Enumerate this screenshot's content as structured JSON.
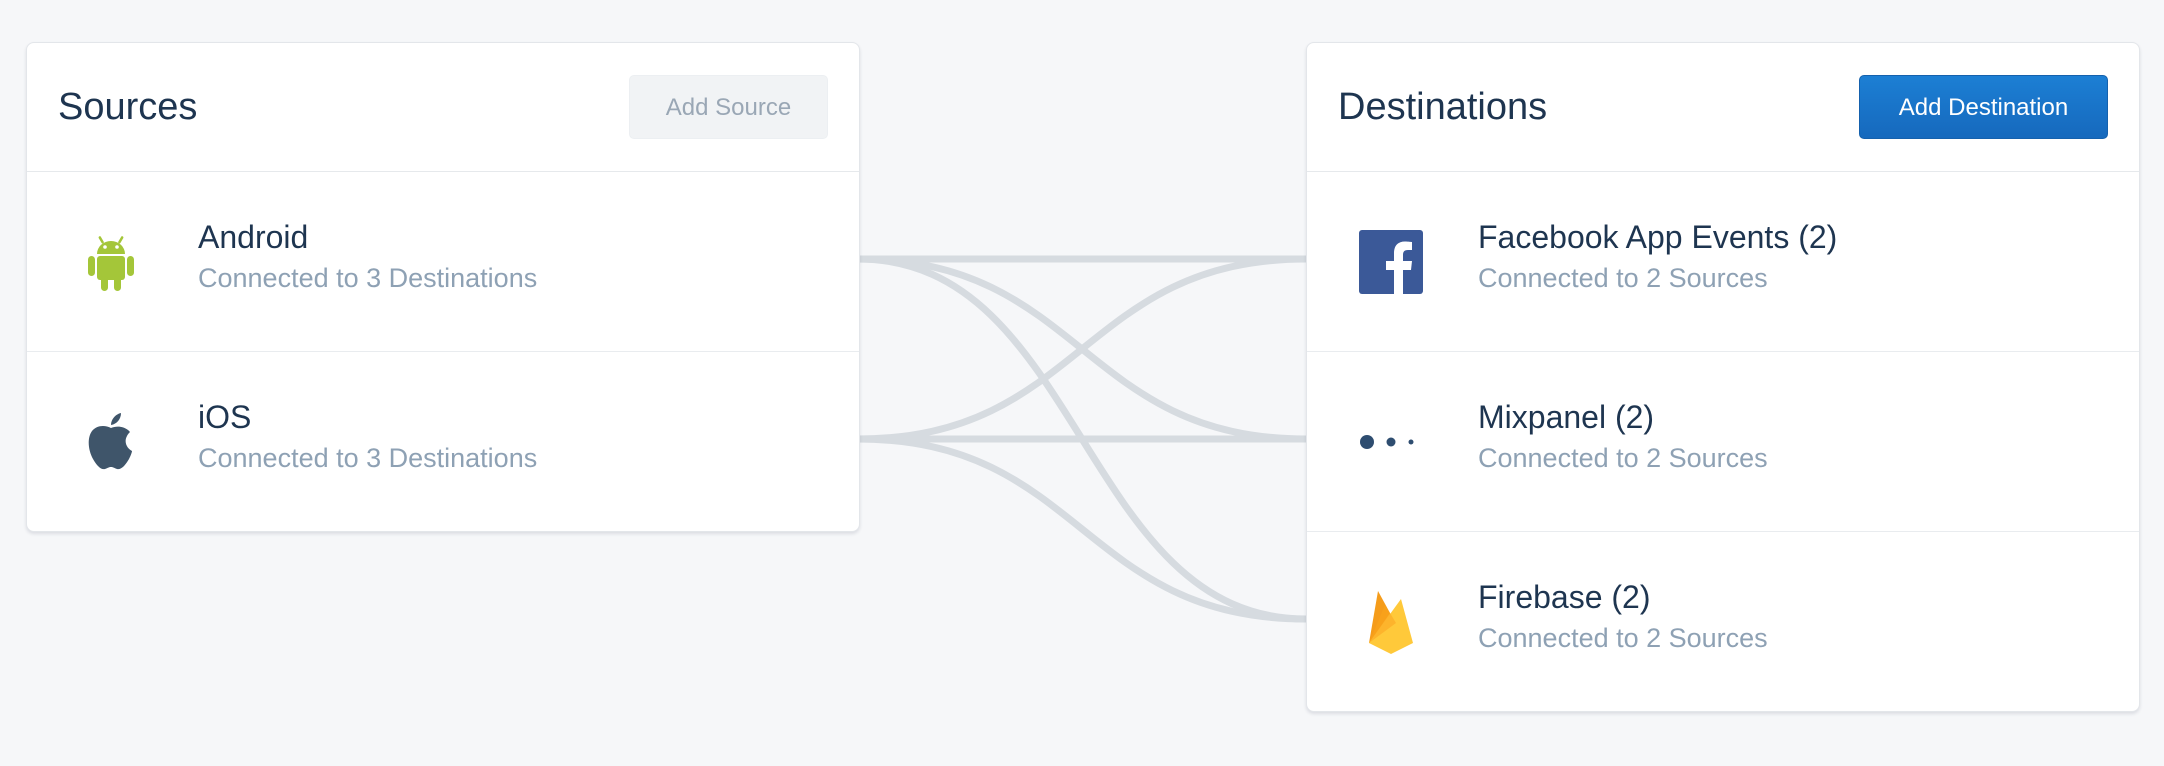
{
  "colors": {
    "page_background": "#f6f7f9",
    "title_text": "#1e3550",
    "secondary_text": "#8ea1b4",
    "primary_button": "#1876cc",
    "connection_line": "#d6dbe0"
  },
  "sources": {
    "title": "Sources",
    "add_button_label": "Add Source",
    "items": [
      {
        "name": "Android",
        "subtitle": "Connected to 3 Destinations",
        "icon": "android-icon"
      },
      {
        "name": "iOS",
        "subtitle": "Connected to 3 Destinations",
        "icon": "apple-icon"
      }
    ]
  },
  "destinations": {
    "title": "Destinations",
    "add_button_label": "Add Destination",
    "items": [
      {
        "name": "Facebook App Events (2)",
        "subtitle": "Connected to 2 Sources",
        "icon": "facebook-icon"
      },
      {
        "name": "Mixpanel (2)",
        "subtitle": "Connected to 2 Sources",
        "icon": "mixpanel-icon"
      },
      {
        "name": "Firebase (2)",
        "subtitle": "Connected to 2 Sources",
        "icon": "firebase-icon"
      }
    ]
  },
  "connections": [
    {
      "from": "Android",
      "to": "Facebook App Events (2)"
    },
    {
      "from": "Android",
      "to": "Mixpanel (2)"
    },
    {
      "from": "Android",
      "to": "Firebase (2)"
    },
    {
      "from": "iOS",
      "to": "Facebook App Events (2)"
    },
    {
      "from": "iOS",
      "to": "Mixpanel (2)"
    },
    {
      "from": "iOS",
      "to": "Firebase (2)"
    }
  ]
}
